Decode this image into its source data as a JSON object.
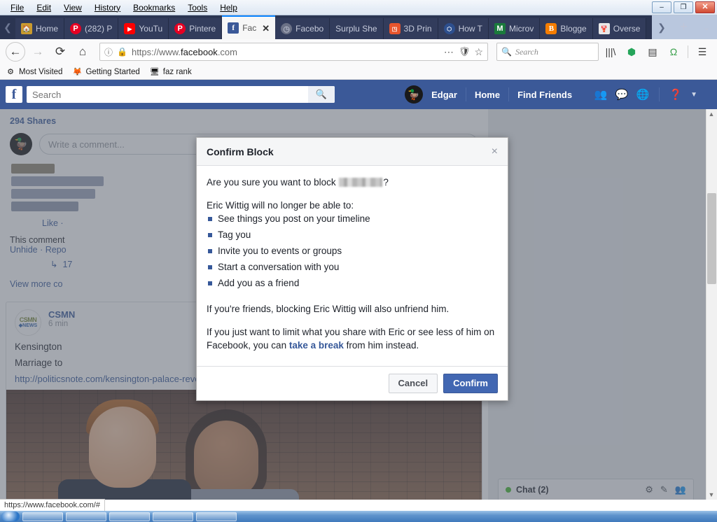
{
  "window": {
    "menus": [
      "File",
      "Edit",
      "View",
      "History",
      "Bookmarks",
      "Tools",
      "Help"
    ],
    "controls": {
      "minimize": "–",
      "restore": "❐",
      "close": "✕"
    }
  },
  "browser": {
    "tabs": [
      {
        "label": "Home",
        "favicon": "home-icon",
        "active": false
      },
      {
        "label": "(282) P",
        "favicon": "pinterest-icon",
        "active": false
      },
      {
        "label": "YouTu",
        "favicon": "youtube-icon",
        "active": false
      },
      {
        "label": "Pintere",
        "favicon": "pinterest-icon",
        "active": false
      },
      {
        "label": "Fac",
        "favicon": "facebook-icon",
        "active": true
      },
      {
        "label": "Facebo",
        "favicon": "clock-icon",
        "active": false
      },
      {
        "label": "Surplu She",
        "favicon": "none",
        "active": false
      },
      {
        "label": "3D Prin",
        "favicon": "3dprint-icon",
        "active": false
      },
      {
        "label": "How T",
        "favicon": "howto-icon",
        "active": false
      },
      {
        "label": "Microv",
        "favicon": "microsoft-icon",
        "active": false
      },
      {
        "label": "Blogge",
        "favicon": "blogger-icon",
        "active": false
      },
      {
        "label": "Overse",
        "favicon": "overseas-icon",
        "active": false
      }
    ],
    "tab_close_label": "✕",
    "new_tab_label": "+",
    "tab_list_label": "⌄",
    "tab_scroll_left": "❮",
    "tab_scroll_right": "❯",
    "nav": {
      "back": "←",
      "forward": "→",
      "reload": "⟳",
      "home": "⌂",
      "identity_icon": "ⓘ",
      "lock_icon": "🔒",
      "url_prefix": "https://www.",
      "url_domain": "facebook",
      "url_suffix": ".com",
      "page_actions": "⋯",
      "pocket": "pocket-icon",
      "bookmark_star": "☆"
    },
    "search": {
      "placeholder": "Search",
      "icon": "search-add-icon"
    },
    "toolbar_icons": [
      "library-icon",
      "shield-icon",
      "sidebar-icon",
      "screenshot-icon",
      "menu-icon"
    ],
    "bookmarks": [
      {
        "label": "Most Visited",
        "icon": "gear-icon"
      },
      {
        "label": "Getting Started",
        "icon": "firefox-icon"
      },
      {
        "label": "faz rank",
        "icon": "monitor-icon"
      }
    ]
  },
  "facebook": {
    "logo": "f",
    "search_placeholder": "Search",
    "search_value": "",
    "search_button_icon": "search-icon",
    "nav": [
      "Edgar",
      "Home",
      "Find Friends"
    ],
    "profile_name": "Edgar",
    "icons": [
      "friend-requests-icon",
      "messages-icon",
      "notifications-icon",
      "help-icon",
      "account-menu-caret"
    ]
  },
  "feed": {
    "shares": "294 Shares",
    "comment_placeholder": "Write a comment...",
    "like_line": "Like ·",
    "comment_note": "This comment",
    "comment_links": "Unhide · Repo",
    "reply_count": "17",
    "reply_arrow": "↳",
    "view_more": "View more co",
    "post": {
      "page_name": "CSMN",
      "page_logo_top": "CSMN",
      "page_logo_bottom": "◆NEWS",
      "time": "6 min",
      "body_line1": "Kensington",
      "body_line2": "Marriage to",
      "link": "http://politicsnote.com/kensington-palace-reveals-detail-t...?"
    }
  },
  "chat": {
    "label": "Chat (2)",
    "status": "online",
    "icons": [
      "gear-icon",
      "compose-icon",
      "friend-list-icon"
    ],
    "collapse_icon": "▾"
  },
  "modal": {
    "title": "Confirm Block",
    "close_label": "×",
    "question_prefix": "Are you sure you want to block",
    "question_suffix": "?",
    "redacted_name": "",
    "intro": "Eric Wittig will no longer be able to:",
    "bullets": [
      "See things you post on your timeline",
      "Tag you",
      "Invite you to events or groups",
      "Start a conversation with you",
      "Add you as a friend"
    ],
    "unfriend_note": "If you're friends, blocking Eric Wittig will also unfriend him.",
    "limit_note_before": "If you just want to limit what you share with Eric or see less of him on Facebook, you can",
    "limit_link": "take a break",
    "limit_note_after": "from him instead.",
    "cancel_label": "Cancel",
    "confirm_label": "Confirm"
  },
  "status_bar": {
    "url": "https://www.facebook.com/#"
  },
  "colors": {
    "facebook_blue": "#3b5998",
    "confirm_button": "#4267b2",
    "link_blue": "#365899",
    "chat_online": "#42b72a",
    "tab_active_accent": "#0a84ff"
  }
}
